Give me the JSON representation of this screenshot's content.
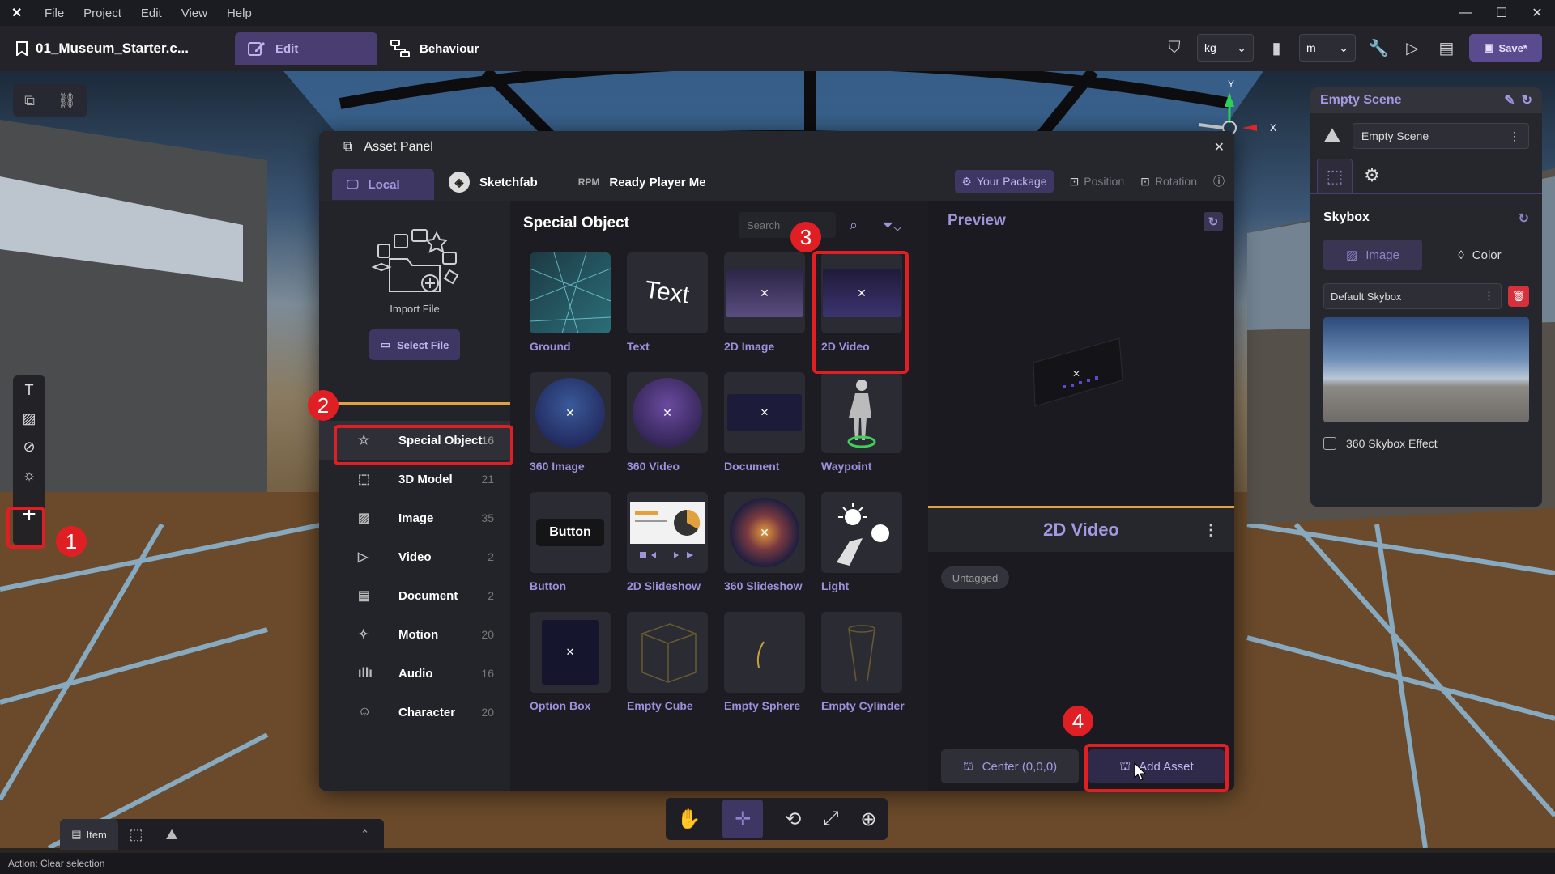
{
  "app": {
    "menu": [
      "File",
      "Project",
      "Edit",
      "View",
      "Help"
    ],
    "project_name": "01_Museum_Starter.c...",
    "tabs": {
      "edit": "Edit",
      "behaviour": "Behaviour"
    },
    "units": {
      "mass": "kg",
      "length": "m"
    },
    "save_label": "Save*"
  },
  "gizmo": {
    "y": "Y",
    "x": "X"
  },
  "inspector": {
    "title": "Empty Scene",
    "scene_select": "Empty Scene",
    "skybox_title": "Skybox",
    "image_label": "Image",
    "color_label": "Color",
    "skybox_select": "Default Skybox",
    "effect_label": "360 Skybox Effect"
  },
  "asset_panel": {
    "title": "Asset Panel",
    "tabs": [
      "Local",
      "Sketchfab",
      "Ready Player Me"
    ],
    "your_package": "Your Package",
    "position": "Position",
    "rotation": "Rotation",
    "import_label": "Import File",
    "select_file": "Select File",
    "categories": [
      {
        "label": "Special Object",
        "count": "16",
        "icon": "star-icon"
      },
      {
        "label": "3D Model",
        "count": "21",
        "icon": "cube-icon"
      },
      {
        "label": "Image",
        "count": "35",
        "icon": "image-icon"
      },
      {
        "label": "Video",
        "count": "2",
        "icon": "play-icon"
      },
      {
        "label": "Document",
        "count": "2",
        "icon": "document-icon"
      },
      {
        "label": "Motion",
        "count": "20",
        "icon": "motion-icon"
      },
      {
        "label": "Audio",
        "count": "16",
        "icon": "audio-icon"
      },
      {
        "label": "Character",
        "count": "20",
        "icon": "character-icon"
      }
    ],
    "grid_title": "Special Object",
    "search_placeholder": "Search",
    "items": [
      "Ground",
      "Text",
      "2D Image",
      "2D Video",
      "360 Image",
      "360 Video",
      "Document",
      "Waypoint",
      "Button",
      "2D Slideshow",
      "360 Slideshow",
      "Light",
      "Option Box",
      "Empty Cube",
      "Empty Sphere",
      "Empty Cylinder"
    ],
    "thumb_text": "Text",
    "thumb_button": "Button",
    "preview_title": "Preview",
    "preview_name": "2D Video",
    "tag": "Untagged",
    "center_label": "Center (0,0,0)",
    "add_asset": "Add Asset"
  },
  "markers": [
    "1",
    "2",
    "3",
    "4"
  ],
  "bottom": {
    "item_tab": "Item"
  },
  "status": "Action: Clear selection",
  "colors": {
    "accent": "#a498e0",
    "highlight": "#e01f24",
    "divider": "#e2a13c"
  }
}
